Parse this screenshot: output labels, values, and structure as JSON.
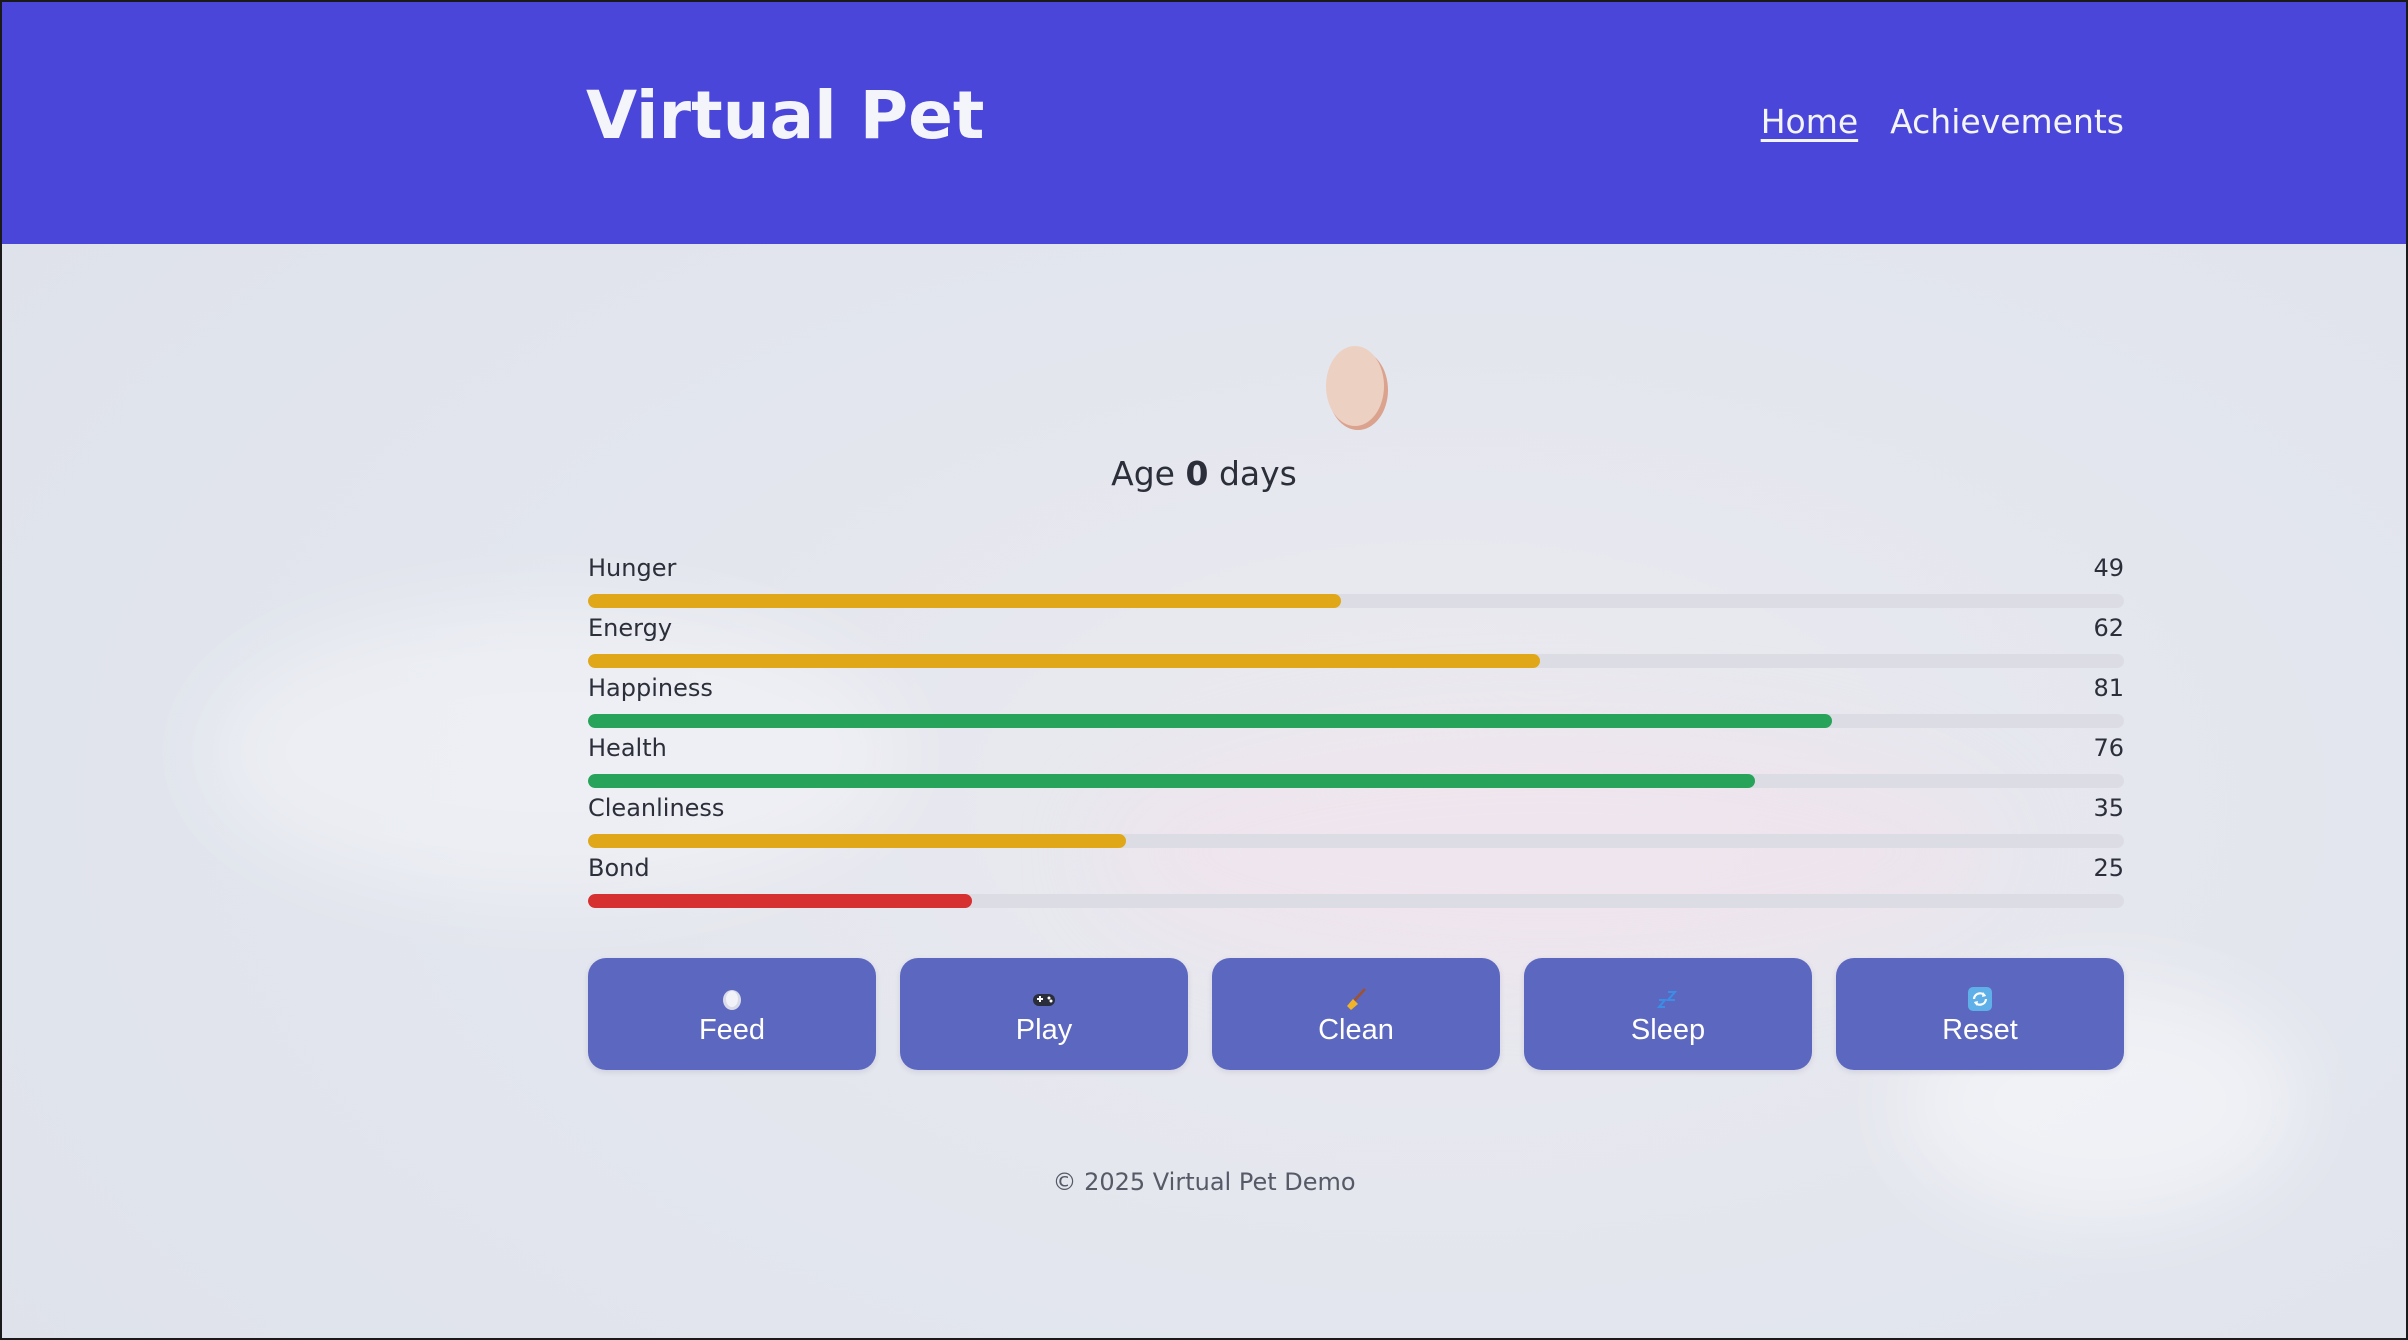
{
  "header": {
    "title": "Virtual Pet",
    "nav": [
      {
        "label": "Home",
        "active": true
      },
      {
        "label": "Achievements",
        "active": false
      }
    ],
    "background_color": "#4a46d9"
  },
  "pet": {
    "icon": "egg-icon",
    "age_prefix": "Age",
    "age_value": "0",
    "age_suffix": "days"
  },
  "stats": [
    {
      "label": "Hunger",
      "value": "49",
      "level": 49,
      "color": "#e0a818"
    },
    {
      "label": "Energy",
      "value": "62",
      "level": 62,
      "color": "#e0a818"
    },
    {
      "label": "Happiness",
      "value": "81",
      "level": 81,
      "color": "#28a35a"
    },
    {
      "label": "Health",
      "value": "76",
      "level": 76,
      "color": "#28a35a"
    },
    {
      "label": "Cleanliness",
      "value": "35",
      "level": 35,
      "color": "#e0a818"
    },
    {
      "label": "Bond",
      "value": "25",
      "level": 25,
      "color": "#d63031"
    }
  ],
  "actions": [
    {
      "label": "Feed",
      "icon": "bowl-icon"
    },
    {
      "label": "Play",
      "icon": "gamepad-icon"
    },
    {
      "label": "Clean",
      "icon": "broom-icon"
    },
    {
      "label": "Sleep",
      "icon": "zzz-icon"
    },
    {
      "label": "Reset",
      "icon": "refresh-icon"
    }
  ],
  "footer": {
    "text": "© 2025 Virtual Pet Demo"
  }
}
